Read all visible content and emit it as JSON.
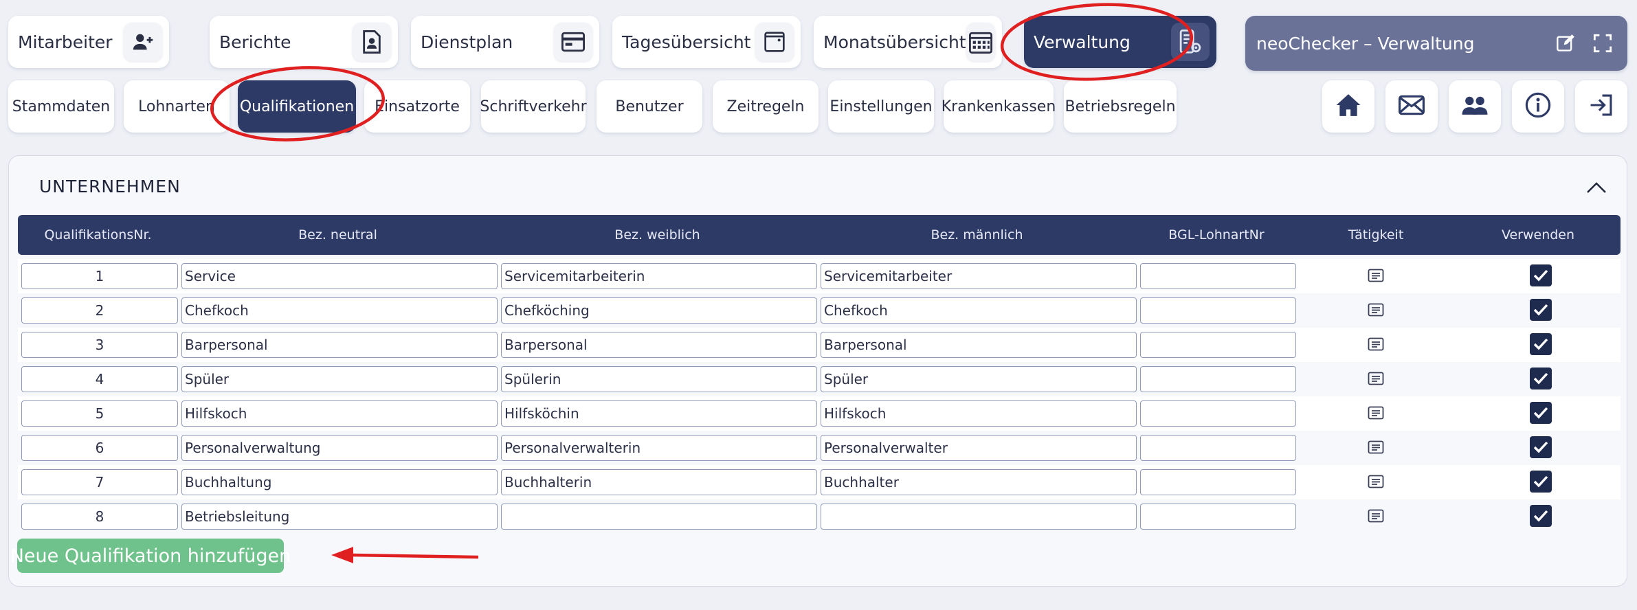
{
  "nav": {
    "tabs": [
      {
        "label": "Mitarbeiter",
        "icon": "add-person-icon"
      },
      {
        "label": "Berichte",
        "icon": "report-icon"
      },
      {
        "label": "Dienstplan",
        "icon": "schedule-icon"
      },
      {
        "label": "Tagesübersicht",
        "icon": "day-view-icon"
      },
      {
        "label": "Monatsübersicht",
        "icon": "calendar-icon"
      },
      {
        "label": "Verwaltung",
        "icon": "admin-settings-icon",
        "active": true
      }
    ]
  },
  "titlebar": {
    "title": "neoChecker – Verwaltung",
    "edit_icon": "edit-icon",
    "fullscreen_icon": "fullscreen-icon"
  },
  "subnav": {
    "tabs": [
      "Stammdaten",
      "Lohnarten",
      "Qualifikationen",
      "Einsatzorte",
      "Schriftverkehr",
      "Benutzer",
      "Zeitregeln",
      "Einstellungen",
      "Krankenkassen",
      "Betriebsregeln"
    ],
    "active": "Qualifikationen"
  },
  "toolbar_icons": [
    "home-icon",
    "mail-icon",
    "users-icon",
    "info-icon",
    "logout-icon"
  ],
  "section": {
    "title": "UNTERNEHMEN"
  },
  "table": {
    "headers": [
      "QualifikationsNr.",
      "Bez. neutral",
      "Bez. weiblich",
      "Bez. männlich",
      "BGL-LohnartNr",
      "Tätigkeit",
      "Verwenden"
    ],
    "rows": [
      {
        "nr": "1",
        "neutral": "Service",
        "weiblich": "Servicemitarbeiterin",
        "maennlich": "Servicemitarbeiter",
        "bgl": "",
        "verwenden": true
      },
      {
        "nr": "2",
        "neutral": "Chefkoch",
        "weiblich": "Chefköching",
        "maennlich": "Chefkoch",
        "bgl": "",
        "verwenden": true
      },
      {
        "nr": "3",
        "neutral": "Barpersonal",
        "weiblich": "Barpersonal",
        "maennlich": "Barpersonal",
        "bgl": "",
        "verwenden": true
      },
      {
        "nr": "4",
        "neutral": "Spüler",
        "weiblich": "Spülerin",
        "maennlich": "Spüler",
        "bgl": "",
        "verwenden": true
      },
      {
        "nr": "5",
        "neutral": "Hilfskoch",
        "weiblich": "Hilfsköchin",
        "maennlich": "Hilfskoch",
        "bgl": "",
        "verwenden": true
      },
      {
        "nr": "6",
        "neutral": "Personalverwaltung",
        "weiblich": "Personalverwalterin",
        "maennlich": "Personalverwalter",
        "bgl": "",
        "verwenden": true
      },
      {
        "nr": "7",
        "neutral": "Buchhaltung",
        "weiblich": "Buchhalterin",
        "maennlich": "Buchhalter",
        "bgl": "",
        "verwenden": true
      },
      {
        "nr": "8",
        "neutral": "Betriebsleitung",
        "weiblich": "",
        "maennlich": "",
        "bgl": "",
        "verwenden": true
      }
    ]
  },
  "add_button": {
    "label": "Neue Qualifikation hinzufügen"
  },
  "colors": {
    "primary": "#2e3a66",
    "accent_green": "#6fc28b",
    "annotation_red": "#e02020",
    "titlebar": "#6a7297"
  }
}
